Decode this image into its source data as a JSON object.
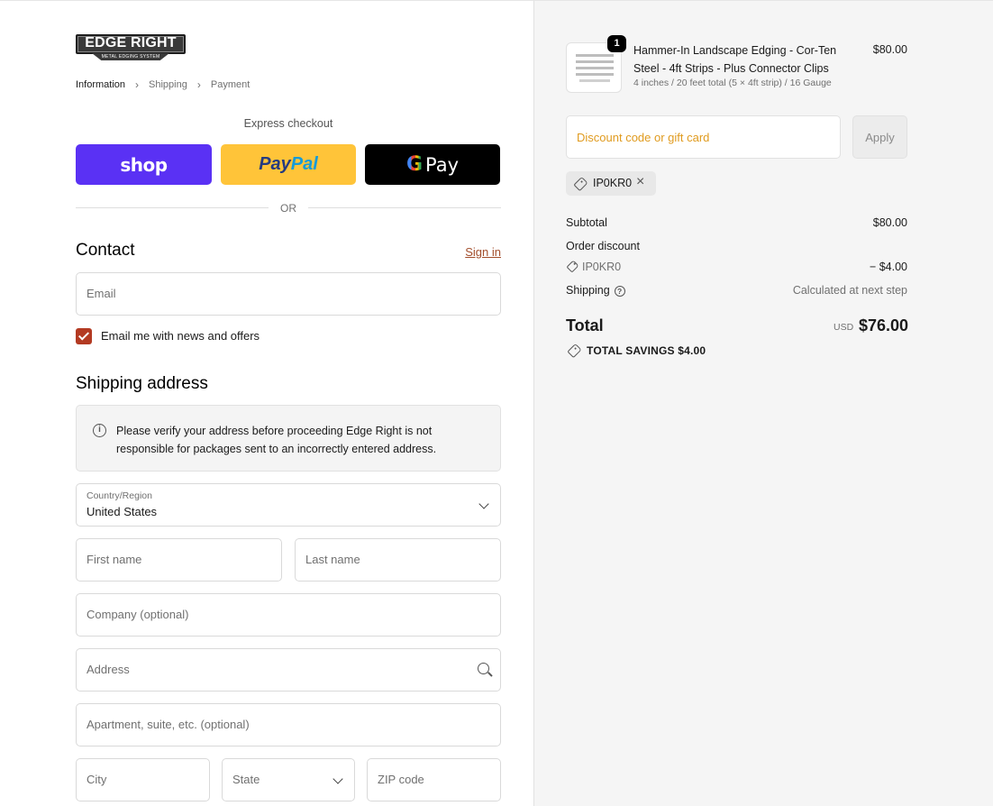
{
  "brand": {
    "logo_text": "EDGE RIGHT",
    "logo_subtext": "METAL EDGING SYSTEM"
  },
  "breadcrumbs": [
    {
      "label": "Information",
      "active": true
    },
    {
      "label": "Shipping",
      "active": false
    },
    {
      "label": "Payment",
      "active": false
    }
  ],
  "express": {
    "label": "Express checkout",
    "shop_label": "shop",
    "paypal_label_1": "Pay",
    "paypal_label_2": "Pal",
    "gpay_g": "G",
    "gpay_label": "Pay",
    "or_label": "OR"
  },
  "contact": {
    "title": "Contact",
    "sign_in": "Sign in",
    "email_placeholder": "Email",
    "news_label": "Email me with news and offers",
    "news_checked": true
  },
  "shipping": {
    "title": "Shipping address",
    "notice": "Please verify your address before proceeding Edge Right is not responsible for packages sent to an incorrectly entered address.",
    "country_label": "Country/Region",
    "country_value": "United States",
    "first_name": "First name",
    "last_name": "Last name",
    "company": "Company (optional)",
    "address": "Address",
    "apartment": "Apartment, suite, etc. (optional)",
    "city": "City",
    "state": "State",
    "zip": "ZIP code"
  },
  "order": {
    "quantity": "1",
    "product_name": "Hammer-In Landscape Edging - Cor-Ten Steel - 4ft Strips - Plus Connector Clips",
    "product_variant": "4 inches / 20 feet total (5 × 4ft strip) / 16 Gauge",
    "product_price": "$80.00",
    "discount_placeholder": "Discount code or gift card",
    "apply_label": "Apply",
    "applied_code": "IP0KR0",
    "subtotal_label": "Subtotal",
    "subtotal_value": "$80.00",
    "order_discount_label": "Order discount",
    "discount_code": "IP0KR0",
    "discount_value": "− $4.00",
    "shipping_label": "Shipping",
    "shipping_value": "Calculated at next step",
    "total_label": "Total",
    "currency": "USD",
    "total_value": "$76.00",
    "savings_label": "TOTAL SAVINGS  $4.00"
  },
  "colors": {
    "shop": "#5a31f4",
    "paypal": "#ffc439",
    "gpay": "#000000",
    "accent": "#b33a22",
    "sign_in": "#a24d2b"
  }
}
